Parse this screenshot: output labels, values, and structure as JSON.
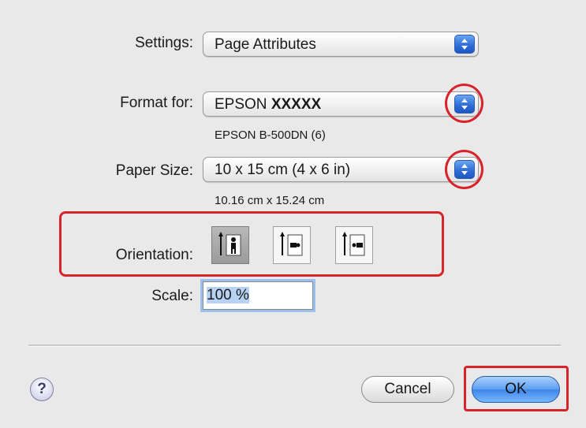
{
  "dialog": {
    "settings": {
      "label": "Settings:",
      "value": "Page Attributes"
    },
    "format_for": {
      "label": "Format for:",
      "value_prefix": "EPSON ",
      "value_bold": "XXXXX",
      "subtext": "EPSON B-500DN (6)"
    },
    "paper_size": {
      "label": "Paper Size:",
      "value": "10 x 15 cm (4 x 6 in)",
      "subtext": "10.16 cm x 15.24 cm"
    },
    "orientation": {
      "label": "Orientation:",
      "options": [
        {
          "name": "portrait",
          "icon": "portrait-orientation-icon",
          "selected": true
        },
        {
          "name": "landscape-left",
          "icon": "landscape-orientation-icon",
          "selected": false
        },
        {
          "name": "landscape-right",
          "icon": "reverse-landscape-orientation-icon",
          "selected": false
        }
      ]
    },
    "scale": {
      "label": "Scale:",
      "value": "100 %"
    },
    "help": {
      "glyph": "?",
      "icon": "help-icon"
    },
    "buttons": {
      "cancel": "Cancel",
      "ok": "OK"
    }
  },
  "colors": {
    "annotation_red": "#d8232a",
    "accent_blue": "#3f86e6",
    "background": "#e9e9e9"
  }
}
